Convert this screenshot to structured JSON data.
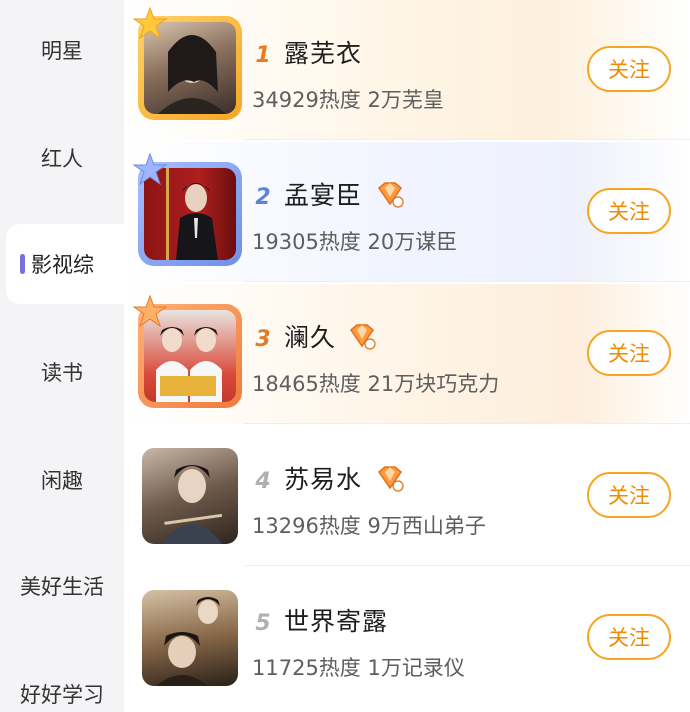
{
  "sidebar": {
    "items": [
      {
        "label": "明星"
      },
      {
        "label": "红人"
      },
      {
        "label": "影视综"
      },
      {
        "label": "读书"
      },
      {
        "label": "闲趣"
      },
      {
        "label": "美好生活"
      },
      {
        "label": "好好学习"
      }
    ],
    "active_index": 2
  },
  "ranking": [
    {
      "rank": "1",
      "name": "露芜衣",
      "meta": "34929热度 2万芜皇",
      "follow_label": "关注",
      "rank_color": "#f07a16",
      "badge": false
    },
    {
      "rank": "2",
      "name": "孟宴臣",
      "meta": "19305热度 20万谋臣",
      "follow_label": "关注",
      "rank_color": "#5b84d6",
      "badge": true
    },
    {
      "rank": "3",
      "name": "澜久",
      "meta": "18465热度 21万块巧克力",
      "follow_label": "关注",
      "rank_color": "#e07b2a",
      "badge": true
    },
    {
      "rank": "4",
      "name": "苏易水",
      "meta": "13296热度 9万西山弟子",
      "follow_label": "关注",
      "rank_color": "#b0b0b0",
      "badge": true
    },
    {
      "rank": "5",
      "name": "世界寄露",
      "meta": "11725热度 1万记录仪",
      "follow_label": "关注",
      "rank_color": "#b0b0b0",
      "badge": false
    }
  ],
  "colors": {
    "accent": "#f5a623",
    "follow_text": "#f08a00",
    "sidebar_marker": "#7a6fd6"
  },
  "icons": [
    "star-icon",
    "vip-badge-icon"
  ]
}
